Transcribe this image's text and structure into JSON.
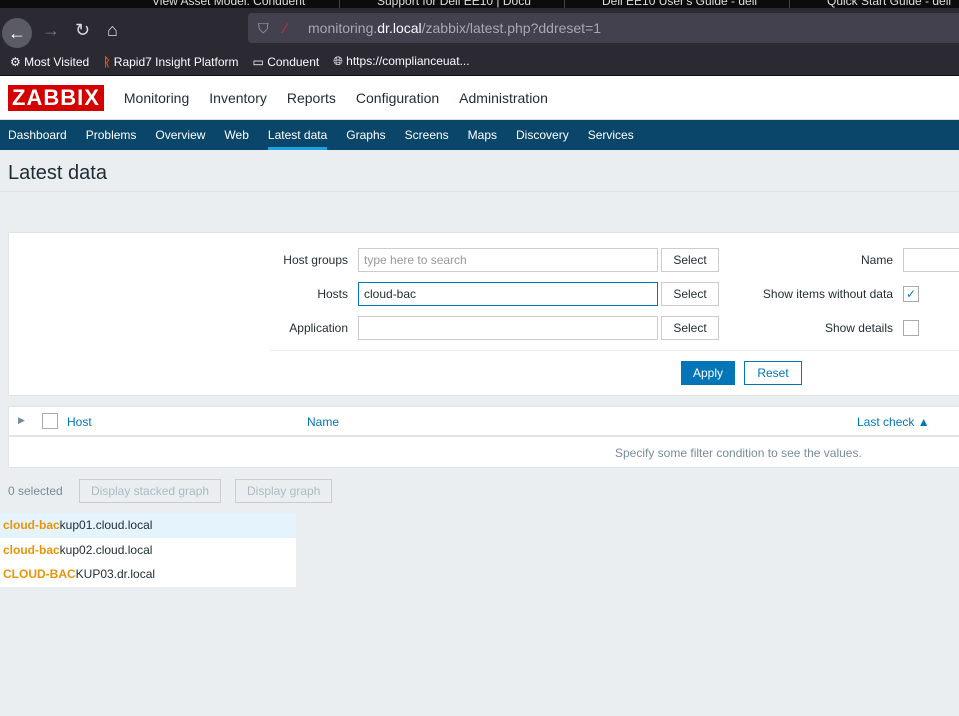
{
  "browser": {
    "tabs": [
      "View Asset Model: Conduent",
      "Support for Dell EE10 | Docu",
      "Dell EE10 User's Guide - dell",
      "Quick Start Guide - dell"
    ],
    "url_prefix": "monitoring.",
    "url_host": "dr.local",
    "url_path": "/zabbix/latest.php?ddreset=1",
    "bookmarks": [
      "Most Visited",
      "Rapid7 Insight Platform",
      "Conduent",
      "https://complianceuat..."
    ]
  },
  "app": {
    "logo": "ZABBIX",
    "main_menu": [
      "Monitoring",
      "Inventory",
      "Reports",
      "Configuration",
      "Administration"
    ],
    "sub_menu": [
      "Dashboard",
      "Problems",
      "Overview",
      "Web",
      "Latest data",
      "Graphs",
      "Screens",
      "Maps",
      "Discovery",
      "Services"
    ]
  },
  "page_title": "Latest data",
  "filter": {
    "host_groups_label": "Host groups",
    "host_groups_placeholder": "type here to search",
    "hosts_label": "Hosts",
    "hosts_value": "cloud-bac",
    "application_label": "Application",
    "select": "Select",
    "name_label": "Name",
    "show_items_label": "Show items without data",
    "show_details_label": "Show details",
    "apply": "Apply",
    "reset": "Reset"
  },
  "table": {
    "host": "Host",
    "name": "Name",
    "last_check": "Last check ▲",
    "empty": "Specify some filter condition to see the values."
  },
  "footer": {
    "selected": "0 selected",
    "stacked": "Display stacked graph",
    "graph": "Display graph"
  },
  "suggestions": [
    {
      "match": "cloud-bac",
      "rest": "kup01.cloud.local"
    },
    {
      "match": "cloud-bac",
      "rest": "kup02.cloud.local"
    },
    {
      "match": "CLOUD-BAC",
      "rest": "KUP03.dr.local"
    }
  ]
}
